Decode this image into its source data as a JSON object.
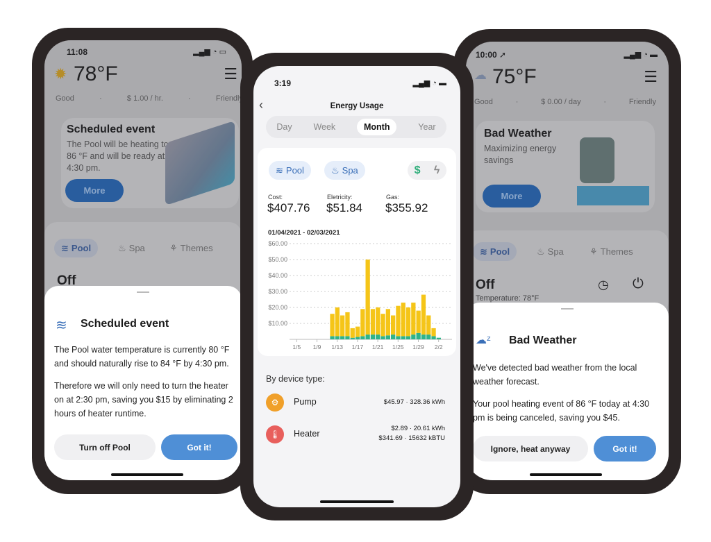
{
  "left": {
    "time": "11:08",
    "temperature": "78",
    "unit": "°F",
    "stats": [
      "Good",
      "$ 1.00 / hr.",
      "Friendly"
    ],
    "card": {
      "title": "Scheduled event",
      "text": "The Pool will be heating to 86 °F and will be ready at 4:30 pm.",
      "button": "More"
    },
    "tabs": [
      "Pool",
      "Spa",
      "Themes"
    ],
    "status": "Off",
    "sheet": {
      "title": "Scheduled event",
      "p1": "The Pool water temperature is currently 80 °F and should naturally rise to 84 °F by 4:30 pm.",
      "p2": "Therefore we will only need to turn the heater on at 2:30 pm, saving you $15 by eliminating 2 hours of heater runtime.",
      "secondary": "Turn off Pool",
      "primary": "Got it!"
    }
  },
  "center": {
    "time": "3:19",
    "title": "Energy Usage",
    "periods": [
      "Day",
      "Week",
      "Month",
      "Year"
    ],
    "active_period": "Month",
    "filters": [
      "Pool",
      "Spa"
    ],
    "cost_label": "Cost:",
    "cost": "$407.76",
    "elec_label": "Eletricity:",
    "elec": "$51.84",
    "gas_label": "Gas:",
    "gas": "$355.92",
    "range": "01/04/2021 - 02/03/2021",
    "by_device": "By device type:",
    "devices": [
      {
        "name": "Pump",
        "line1": "$45.97 · 328.36 kWh",
        "line2": "",
        "color": "#f0a02a"
      },
      {
        "name": "Heater",
        "line1": "$2.89 · 20.61 kWh",
        "line2": "$341.69 · 15632 kBTU",
        "color": "#e85f5c"
      }
    ]
  },
  "chart_data": {
    "type": "bar",
    "stacked": true,
    "ylim": [
      0,
      60
    ],
    "yticks": [
      "$60.00",
      "$50.00",
      "$40.00",
      "$30.00",
      "$20.00",
      "$10.00"
    ],
    "ytick_values": [
      60,
      50,
      40,
      30,
      20,
      10
    ],
    "xticks": [
      "1/5",
      "1/9",
      "1/13",
      "1/17",
      "1/21",
      "1/25",
      "1/29",
      "2/2"
    ],
    "grid": true,
    "categories": [
      "1/12",
      "1/13",
      "1/14",
      "1/15",
      "1/16",
      "1/17",
      "1/18",
      "1/19",
      "1/20",
      "1/21",
      "1/22",
      "1/23",
      "1/24",
      "1/25",
      "1/26",
      "1/27",
      "1/28",
      "1/29",
      "1/30",
      "1/31",
      "2/1",
      "2/2"
    ],
    "series": [
      {
        "values": [
          2,
          2,
          2,
          2,
          1,
          1.5,
          2,
          3,
          3,
          3,
          2,
          2.5,
          3,
          2,
          2,
          2,
          3,
          4,
          3,
          3,
          2,
          1
        ],
        "color": "#2fb38a"
      },
      {
        "values": [
          14,
          18,
          13,
          15,
          6,
          6.5,
          17,
          47,
          16,
          17,
          14,
          16.5,
          12,
          19,
          21,
          18,
          20,
          14,
          25,
          12,
          5,
          0
        ],
        "color": "#f5c518"
      }
    ]
  },
  "right": {
    "time": "10:00",
    "temperature": "75",
    "unit": "°F",
    "stats": [
      "Good",
      "$ 0.00 / day",
      "Friendly"
    ],
    "card": {
      "title": "Bad Weather",
      "text": "Maximizing energy savings",
      "button": "More"
    },
    "tabs": [
      "Pool",
      "Spa",
      "Themes"
    ],
    "status": "Off",
    "temp_line": "Temperature: 78°F",
    "sheet": {
      "title": "Bad Weather",
      "p1": "We've detected bad weather from the local weather forecast.",
      "p2": "Your pool heating event of 86 °F today at 4:30 pm is being canceled, saving you $45.",
      "secondary": "Ignore, heat anyway",
      "primary": "Got it!"
    }
  }
}
